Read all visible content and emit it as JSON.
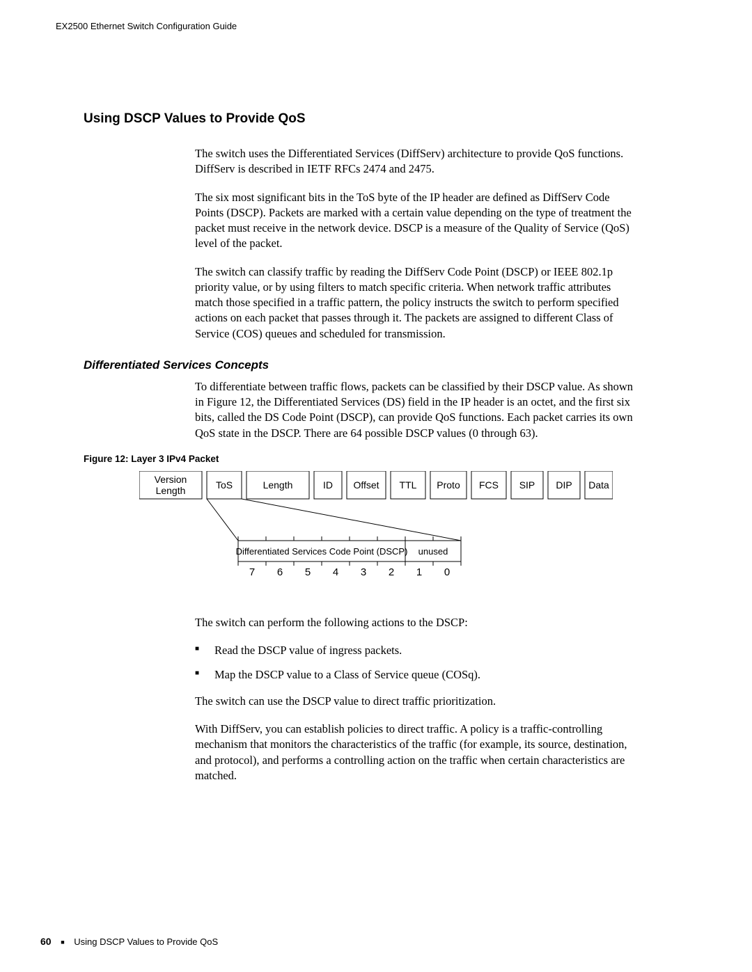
{
  "header": {
    "running": "EX2500 Ethernet Switch Configuration Guide"
  },
  "section": {
    "h1": "Using DSCP Values to Provide QoS",
    "p1": "The switch uses the Differentiated Services (DiffServ) architecture to provide QoS functions. DiffServ is described in IETF RFCs 2474 and 2475.",
    "p2": "The six most significant bits in the ToS byte of the IP header are defined as DiffServ Code Points (DSCP). Packets are marked with a certain value depending on the type of treatment the packet must receive in the network device. DSCP is a measure of the Quality of Service (QoS) level of the packet.",
    "p3": "The switch can classify traffic by reading the DiffServ Code Point (DSCP) or IEEE 802.1p priority value, or by using filters to match specific criteria. When network traffic attributes match those specified in a traffic pattern, the policy instructs the switch to perform specified actions on each packet that passes through it. The packets are assigned to different Class of Service (COS) queues and scheduled for transmission."
  },
  "subsection": {
    "h2": "Differentiated Services Concepts",
    "p1": "To differentiate between traffic flows, packets can be classified by their DSCP value. As shown in Figure 12, the Differentiated Services (DS) field in the IP header is an octet, and the first six bits, called the DS Code Point (DSCP), can provide QoS functions. Each packet carries its own QoS state in the DSCP. There are 64 possible DSCP values (0 through 63)."
  },
  "figure": {
    "caption": "Figure 12:  Layer 3 IPv4 Packet",
    "fields": [
      "Version Length",
      "ToS",
      "Length",
      "ID",
      "Offset",
      "TTL",
      "Proto",
      "FCS",
      "SIP",
      "DIP",
      "Data"
    ],
    "detail_dscp": "Differentiated Services Code Point (DSCP)",
    "detail_unused": "unused",
    "bits": [
      "7",
      "6",
      "5",
      "4",
      "3",
      "2",
      "1",
      "0"
    ]
  },
  "after_figure": {
    "p1": "The switch can perform the following actions to the DSCP:",
    "li1": "Read the DSCP value of ingress packets.",
    "li2": "Map the DSCP value to a Class of Service queue (COSq).",
    "p2": "The switch can use the DSCP value to direct traffic prioritization.",
    "p3": "With DiffServ, you can establish policies to direct traffic. A policy is a traffic-controlling mechanism that monitors the characteristics of the traffic (for example, its source, destination, and protocol), and performs a controlling action on the traffic when certain characteristics are matched."
  },
  "footer": {
    "page_no": "60",
    "section": "Using DSCP Values to Provide QoS"
  }
}
